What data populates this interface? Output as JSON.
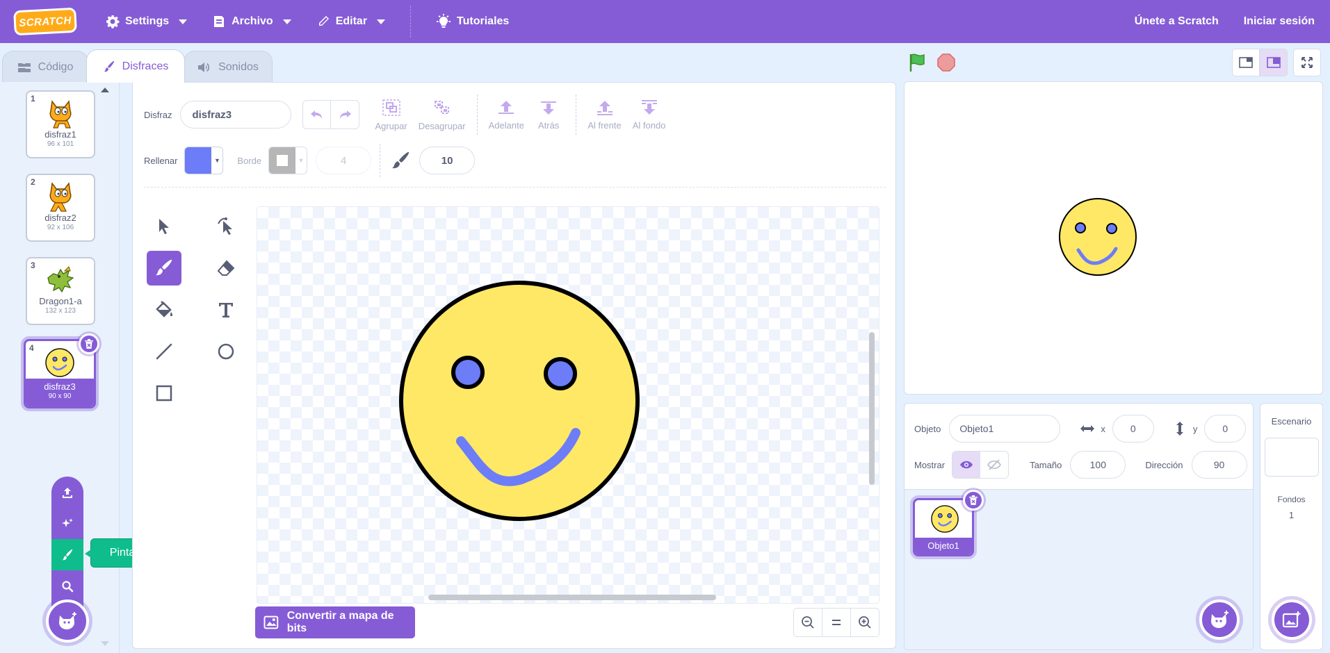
{
  "menubar": {
    "logo": "SCRATCH",
    "settings": "Settings",
    "file": "Archivo",
    "edit": "Editar",
    "tutorials": "Tutoriales",
    "join": "Únete a Scratch",
    "signin": "Iniciar sesión"
  },
  "tabs": {
    "code": "Código",
    "costumes": "Disfraces",
    "sounds": "Sonidos"
  },
  "costumes": [
    {
      "num": "1",
      "name": "disfraz1",
      "size": "96 x 101",
      "icon": "cat-icon"
    },
    {
      "num": "2",
      "name": "disfraz2",
      "size": "92 x 106",
      "icon": "cat-icon"
    },
    {
      "num": "3",
      "name": "Dragon1-a",
      "size": "132 x 123",
      "icon": "dragon-icon"
    },
    {
      "num": "4",
      "name": "disfraz3",
      "size": "90 x 90",
      "icon": "smiley-icon"
    }
  ],
  "tooltip": "Pinta",
  "editor": {
    "costume_label": "Disfraz",
    "costume_name": "disfraz3",
    "group": "Agrupar",
    "ungroup": "Desagrupar",
    "forward": "Adelante",
    "backward": "Atrás",
    "front": "Al frente",
    "back": "Al fondo",
    "fill_label": "Rellenar",
    "fill_color": "#6c7df7",
    "outline_label": "Borde",
    "outline_width": "4",
    "brush_size": "10",
    "convert": "Convertir a mapa de bits"
  },
  "sprite": {
    "label": "Objeto",
    "name": "Objeto1",
    "x_label": "x",
    "x": "0",
    "y_label": "y",
    "y": "0",
    "show_label": "Mostrar",
    "size_label": "Tamaño",
    "size": "100",
    "direction_label": "Dirección",
    "direction": "90",
    "tile_name": "Objeto1"
  },
  "stage_pane": {
    "title": "Escenario",
    "backdrops_label": "Fondos",
    "backdrops_count": "1"
  },
  "colors": {
    "accent": "#855cd6",
    "paint_green": "#0fbd8c",
    "face_fill": "#ffe866",
    "eye_fill": "#6c7df7"
  }
}
